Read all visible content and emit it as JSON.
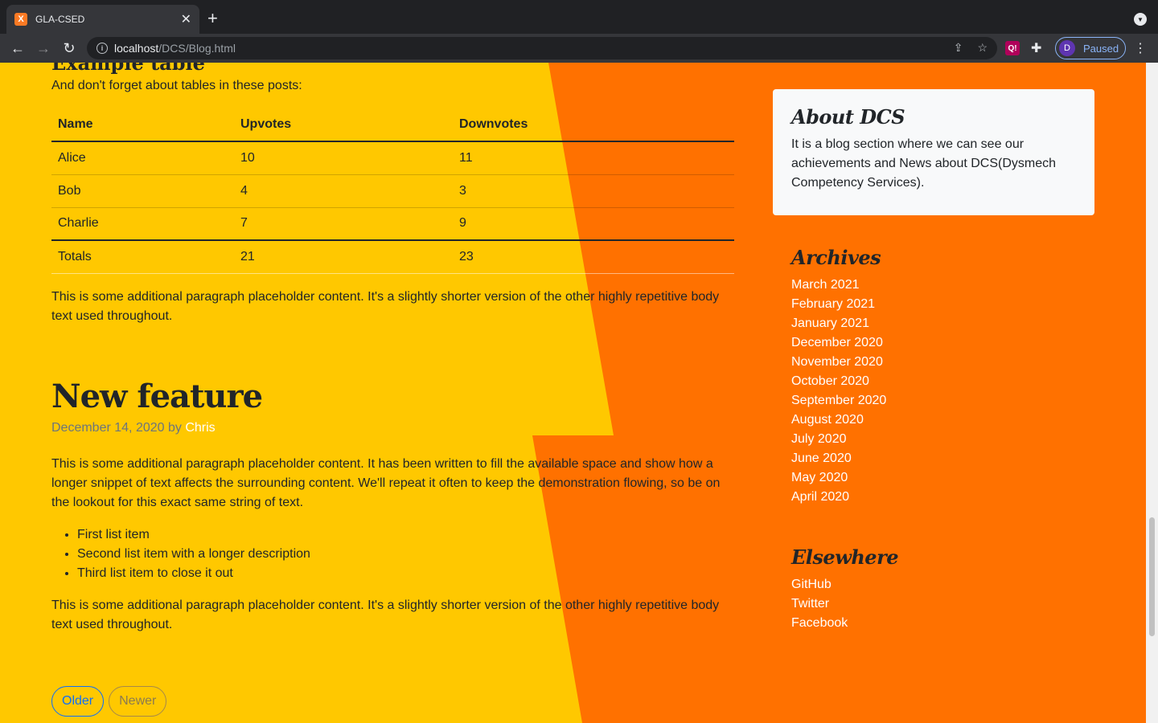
{
  "browser": {
    "tab_title": "GLA-CSED",
    "tab_favicon": "X",
    "new_tab": "+",
    "close": "✕",
    "url_host": "localhost",
    "url_path": "/DCS/Blog.html",
    "profile_initial": "D",
    "profile_status": "Paused",
    "ext_label": "Q!"
  },
  "post1": {
    "heading_partial": "Example table",
    "intro": "And don't forget about tables in these posts:",
    "table": {
      "headers": [
        "Name",
        "Upvotes",
        "Downvotes"
      ],
      "rows": [
        [
          "Alice",
          "10",
          "11"
        ],
        [
          "Bob",
          "4",
          "3"
        ],
        [
          "Charlie",
          "7",
          "9"
        ]
      ],
      "footer": [
        "Totals",
        "21",
        "23"
      ]
    },
    "outro": "This is some additional paragraph placeholder content. It's a slightly shorter version of the other highly repetitive body text used throughout."
  },
  "post2": {
    "title": "New feature",
    "date": "December 14, 2020 by",
    "author": "Chris",
    "para1": "This is some additional paragraph placeholder content. It has been written to fill the available space and show how a longer snippet of text affects the surrounding content. We'll repeat it often to keep the demonstration flowing, so be on the lookout for this exact same string of text.",
    "list": [
      "First list item",
      "Second list item with a longer description",
      "Third list item to close it out"
    ],
    "para2": "This is some additional paragraph placeholder content. It's a slightly shorter version of the other highly repetitive body text used throughout."
  },
  "pager": {
    "older": "Older",
    "newer": "Newer"
  },
  "sidebar": {
    "about_title": "About DCS",
    "about_text": "It is a blog section where we can see our achievements and News about DCS(Dysmech Competency Services).",
    "archives_title": "Archives",
    "archives": [
      "March 2021",
      "February 2021",
      "January 2021",
      "December 2020",
      "November 2020",
      "October 2020",
      "September 2020",
      "August 2020",
      "July 2020",
      "June 2020",
      "May 2020",
      "April 2020"
    ],
    "elsewhere_title": "Elsewhere",
    "elsewhere": [
      "GitHub",
      "Twitter",
      "Facebook"
    ]
  },
  "colors": {
    "background": "#ff7100",
    "yellow": "#ffc800",
    "link": "#ffffff"
  }
}
